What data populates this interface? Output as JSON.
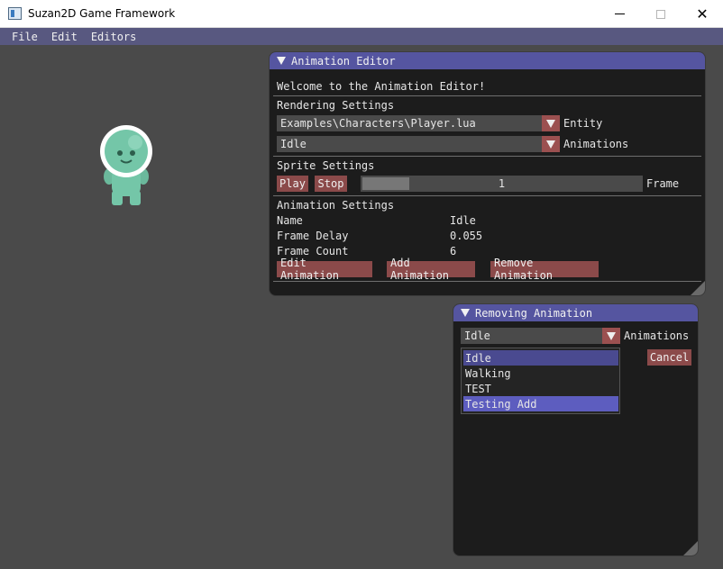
{
  "window": {
    "title": "Suzan2D Game Framework",
    "minimize_icon": "minimize-icon",
    "maximize_icon": "maximize-icon",
    "close_glyph": "✕"
  },
  "menubar": {
    "items": [
      "File",
      "Edit",
      "Editors"
    ]
  },
  "colors": {
    "title_bar": "#5555a0",
    "menubar": "#585880",
    "button": "#8b4a4a",
    "combo_arrow": "#9b5050",
    "background": "#4a4a4a",
    "panel": "#1c1c1c",
    "character": "#74c6a8"
  },
  "animation_editor": {
    "title": "Animation Editor",
    "welcome": "Welcome to the Animation Editor!",
    "rendering_header": "Rendering Settings",
    "entity_value": "Examples\\Characters\\Player.lua",
    "entity_label": "Entity",
    "animations_value": "Idle",
    "animations_label": "Animations",
    "sprite_header": "Sprite Settings",
    "play_label": "Play",
    "stop_label": "Stop",
    "frame_value": "1",
    "frame_label": "Frame",
    "anim_header": "Animation Settings",
    "props": [
      {
        "key": "Name",
        "value": "Idle"
      },
      {
        "key": "Frame Delay",
        "value": "0.055"
      },
      {
        "key": "Frame Count",
        "value": "6"
      }
    ],
    "edit_label": "Edit Animation",
    "add_label": "Add Animation",
    "remove_label": "Remove Animation"
  },
  "removing_dialog": {
    "title": "Removing Animation",
    "combo_value": "Idle",
    "combo_label": "Animations",
    "cancel_label": "Cancel",
    "options": [
      "Idle",
      "Walking",
      "TEST",
      "Testing Add"
    ]
  }
}
